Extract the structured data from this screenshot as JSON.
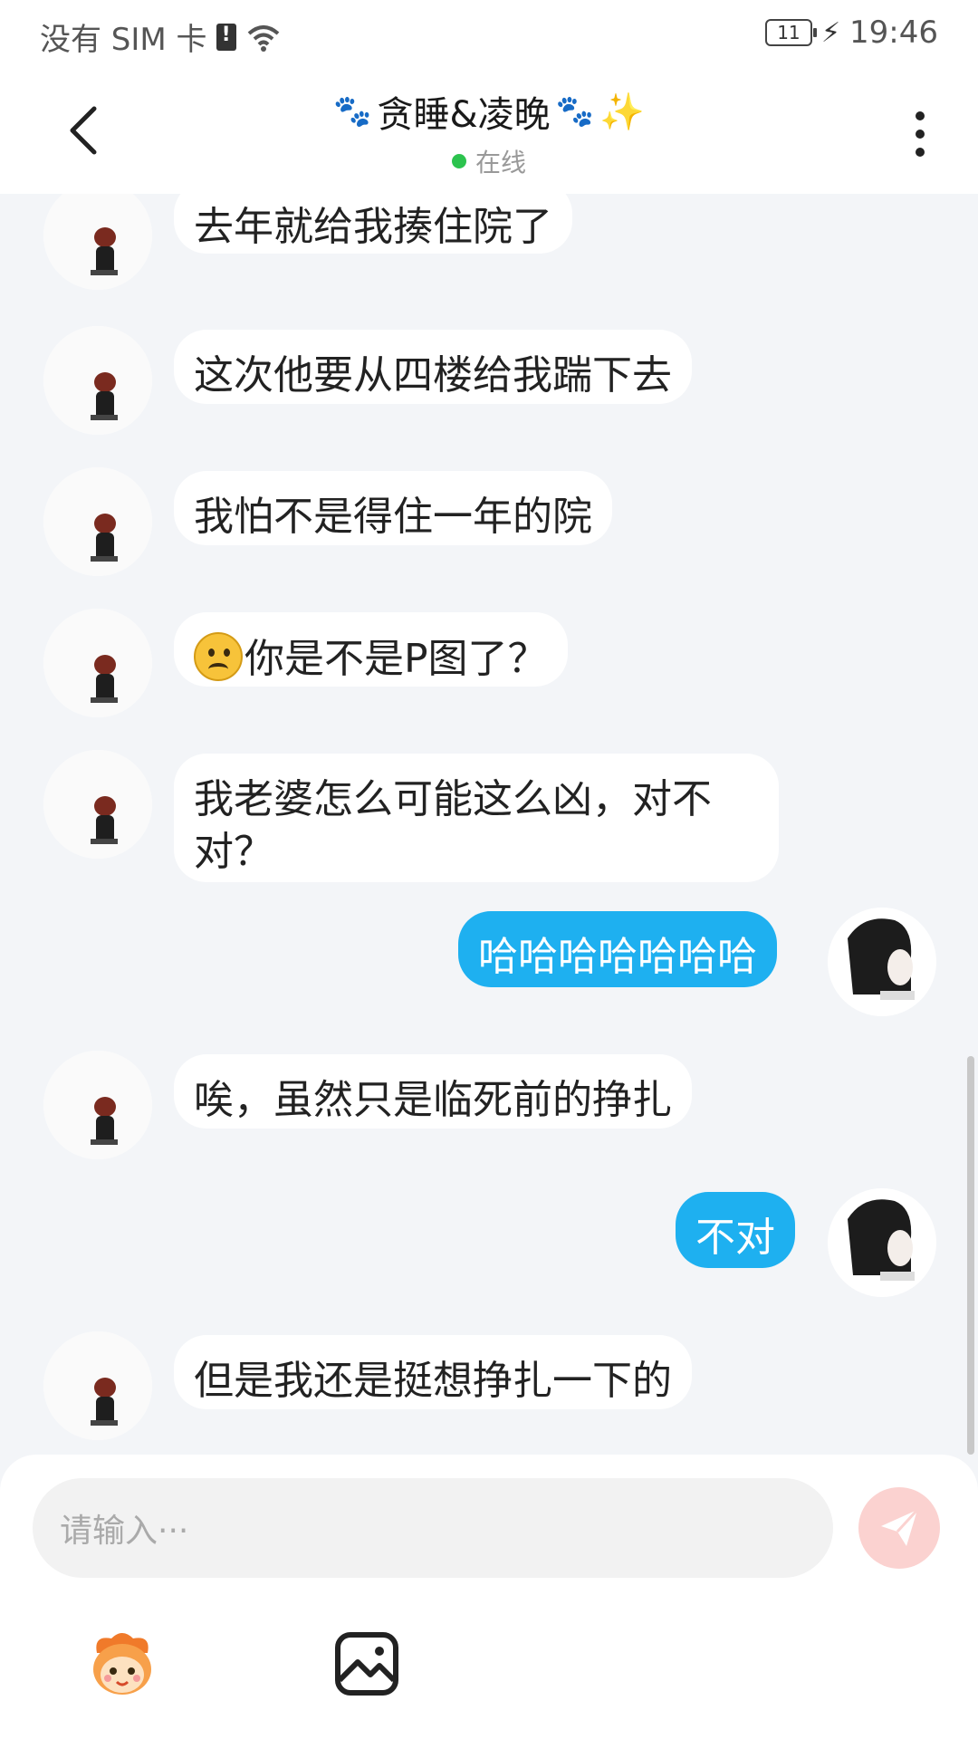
{
  "status_bar": {
    "carrier": "没有 SIM 卡",
    "battery": "11",
    "time": "19:46"
  },
  "header": {
    "title": "贪睡&凌晚",
    "status": "在线"
  },
  "colors": {
    "outgoing_bubble": "#1eb0f0",
    "incoming_bubble": "#ffffff",
    "background": "#f3f5f8",
    "online": "#2cc34e",
    "send_button": "#fbd2d0"
  },
  "messages": [
    {
      "side": "in",
      "text": "去年就给我揍住院了"
    },
    {
      "side": "in",
      "text": "这次他要从四楼给我踹下去"
    },
    {
      "side": "in",
      "text": "我怕不是得住一年的院"
    },
    {
      "side": "in",
      "emoji": "frowning-face",
      "text": "你是不是P图了？"
    },
    {
      "side": "in",
      "text": "我老婆怎么可能这么凶，对不\n对？"
    },
    {
      "side": "out",
      "text": "哈哈哈哈哈哈哈"
    },
    {
      "side": "in",
      "text": "唉，虽然只是临死前的挣扎"
    },
    {
      "side": "out",
      "text": "不对"
    },
    {
      "side": "in",
      "text": "但是我还是挺想挣扎一下的"
    }
  ],
  "input": {
    "placeholder": "请输入···"
  },
  "icons": {
    "back": "back-arrow-icon",
    "more": "more-vertical-icon",
    "send": "paper-plane-icon",
    "sticker": "mascot-sticker-icon",
    "image": "image-icon"
  }
}
